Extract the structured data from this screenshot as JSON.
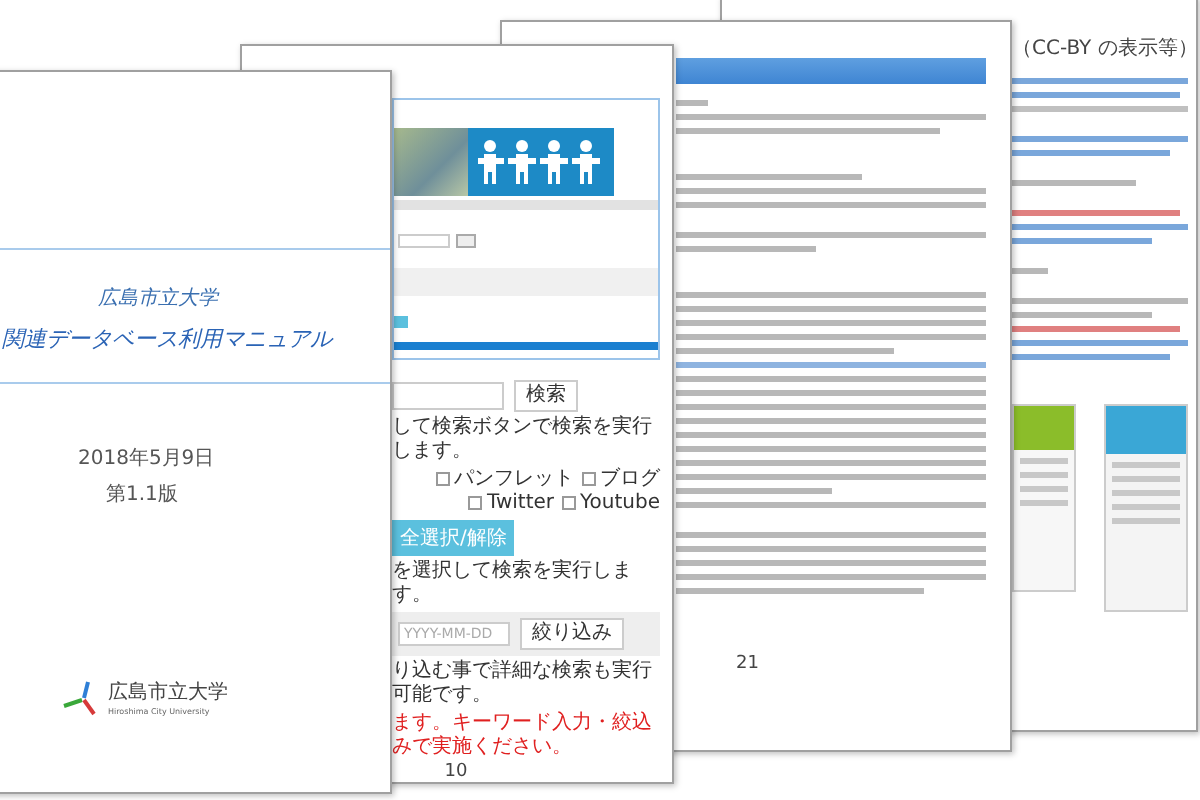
{
  "cover": {
    "subtitle": "広島市立大学",
    "title": "関連データベース利用マニュアル",
    "date": "2018年5月9日",
    "edition": "第1.1版",
    "logo": {
      "name": "広島市立大学",
      "english": "Hiroshima City University"
    }
  },
  "search_page": {
    "search_button": "検索",
    "instruction": "して検索ボタンで検索を実行します。",
    "checkboxes": [
      {
        "label": "パンフレット",
        "checked": false
      },
      {
        "label": "ブログ",
        "checked": false
      },
      {
        "label": "Twitter",
        "checked": false
      },
      {
        "label": "Youtube",
        "checked": false
      }
    ],
    "select_all_button": "全選択/解除",
    "category_instruction": "を選択して検索を実行します。",
    "date_field": {
      "placeholder": "YYYY-MM-DD"
    },
    "filter_button": "絞り込み",
    "filter_instruction": "り込む事で詳細な検索も実行可能です。",
    "notice": "ます。キーワード入力・絞込みで実施ください。",
    "page_number": "10"
  },
  "terms_page": {
    "page_number": "21"
  },
  "license_page": {
    "heading": "（CC-BY の表示等）"
  }
}
